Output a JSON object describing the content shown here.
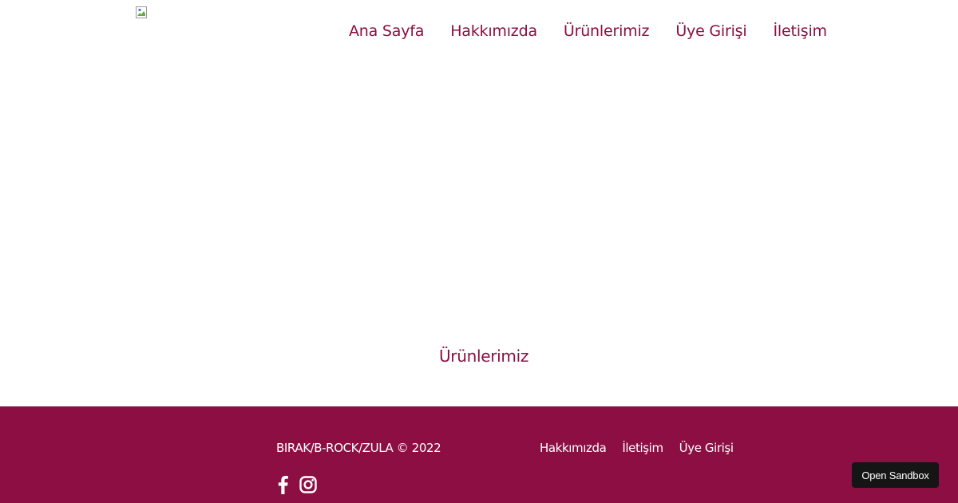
{
  "header": {
    "logo_icon": "broken-image-icon",
    "nav": [
      {
        "label": "Ana Sayfa"
      },
      {
        "label": "Hakkımızda"
      },
      {
        "label": "Ürünlerimiz"
      },
      {
        "label": "Üye Girişi"
      },
      {
        "label": "İletişim"
      }
    ]
  },
  "main": {
    "section_title": "Ürünlerimiz"
  },
  "footer": {
    "copyright": "BIRAK/B-ROCK/ZULA © 2022",
    "links": [
      {
        "label": "Hakkımızda"
      },
      {
        "label": "İletişim"
      },
      {
        "label": "Üye Girişi"
      }
    ],
    "social_icons": [
      "facebook-icon",
      "instagram-icon"
    ]
  },
  "sandbox": {
    "label": "Open Sandbox"
  },
  "colors": {
    "brand": "#8c0e42",
    "text_on_brand": "#ffffff",
    "sandbox_bg": "#151515"
  }
}
